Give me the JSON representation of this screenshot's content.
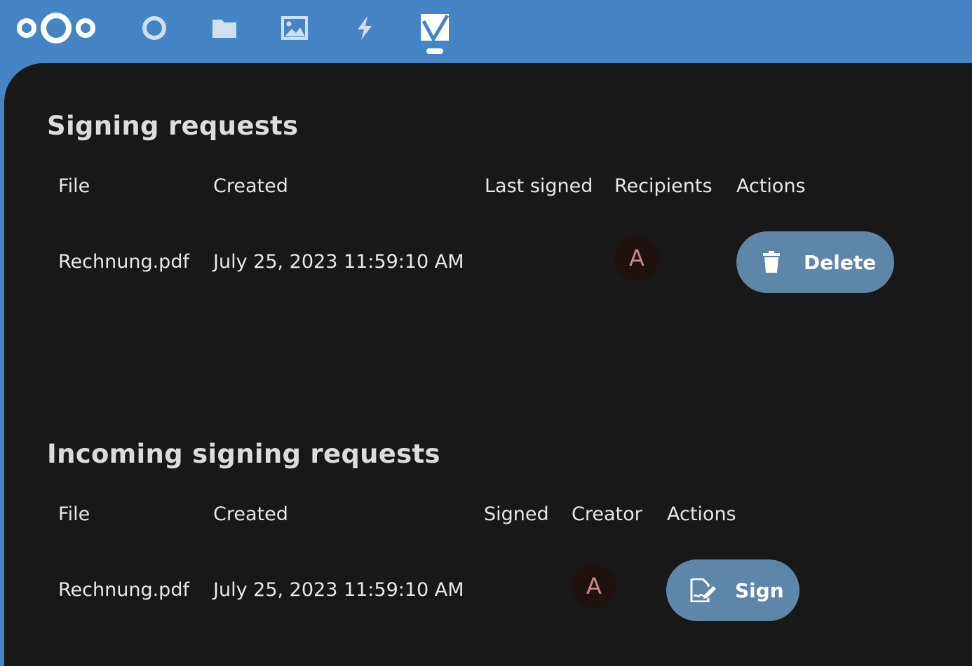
{
  "header": {
    "logo_icon": "nextcloud-logo",
    "apps": [
      {
        "name": "dashboard",
        "icon": "circle-icon"
      },
      {
        "name": "files",
        "icon": "folder-icon"
      },
      {
        "name": "photos",
        "icon": "image-icon"
      },
      {
        "name": "activity",
        "icon": "lightning-icon"
      },
      {
        "name": "signing",
        "icon": "signing-app-icon",
        "active": true
      }
    ],
    "bar_color": "#4585c6"
  },
  "outgoing": {
    "title": "Signing requests",
    "columns": [
      "File",
      "Created",
      "Last signed",
      "Recipients",
      "Actions"
    ],
    "rows": [
      {
        "file": "Rechnung.pdf",
        "created": "July 25, 2023 11:59:10 AM",
        "last_signed": "",
        "recipient_initial": "A",
        "action_label": "Delete",
        "action_icon": "trash-icon"
      }
    ]
  },
  "incoming": {
    "title": "Incoming signing requests",
    "columns": [
      "File",
      "Created",
      "Signed",
      "Creator",
      "Actions"
    ],
    "rows": [
      {
        "file": "Rechnung.pdf",
        "created": "July 25, 2023 11:59:10 AM",
        "signed": "",
        "creator_initial": "A",
        "action_label": "Sign",
        "action_icon": "sign-document-icon"
      }
    ]
  },
  "colors": {
    "background": "#181818",
    "button": "#5d86a9",
    "avatar_bg": "#1f1110",
    "avatar_text": "#c48a86"
  }
}
